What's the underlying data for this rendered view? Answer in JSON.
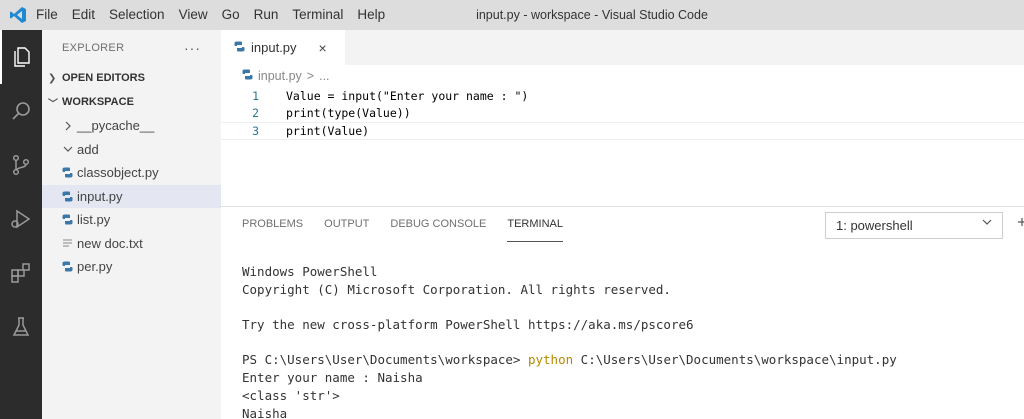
{
  "menu": [
    "File",
    "Edit",
    "Selection",
    "View",
    "Go",
    "Run",
    "Terminal",
    "Help"
  ],
  "window_title": "input.py - workspace - Visual Studio Code",
  "activity_bar": [
    "explorer-icon",
    "search-icon",
    "source-control-icon",
    "run-debug-icon",
    "extensions-icon",
    "testing-icon"
  ],
  "sidebar": {
    "title": "EXPLORER",
    "more": "···",
    "open_editors": "OPEN EDITORS",
    "workspace": "WORKSPACE",
    "items": [
      {
        "label": "__pycache__",
        "type": "folder",
        "expanded": false
      },
      {
        "label": "add",
        "type": "folder",
        "expanded": true
      },
      {
        "label": "classobject.py",
        "type": "python"
      },
      {
        "label": "input.py",
        "type": "python",
        "selected": true
      },
      {
        "label": "list.py",
        "type": "python"
      },
      {
        "label": "new doc.txt",
        "type": "text"
      },
      {
        "label": "per.py",
        "type": "python"
      }
    ]
  },
  "editor": {
    "tab_label": "input.py",
    "tab_close": "×",
    "breadcrumb_file": "input.py",
    "breadcrumb_sep": ">",
    "breadcrumb_rest": "...",
    "lines": [
      {
        "n": "1",
        "text": "Value = input(\"Enter your name : \")"
      },
      {
        "n": "2",
        "text": "print(type(Value))"
      },
      {
        "n": "3",
        "text": "print(Value)"
      }
    ]
  },
  "panel": {
    "tabs": [
      "PROBLEMS",
      "OUTPUT",
      "DEBUG CONSOLE",
      "TERMINAL"
    ],
    "active_tab": "TERMINAL",
    "terminal_select": "1: powershell",
    "terminal": {
      "line1": "Windows PowerShell",
      "line2": "Copyright (C) Microsoft Corporation. All rights reserved.",
      "line3": "Try the new cross-platform PowerShell https://aka.ms/pscore6",
      "prompt": "PS C:\\Users\\User\\Documents\\workspace> ",
      "command": "python",
      "args": " C:\\Users\\User\\Documents\\workspace\\input.py",
      "line5": "Enter your name : Naisha",
      "line6": "<class 'str'>",
      "line7": "Naisha"
    }
  },
  "colors": {
    "python_icon": "#3b78a8",
    "vscode_blue": "#1f8ad2",
    "command": "#b58a00"
  }
}
